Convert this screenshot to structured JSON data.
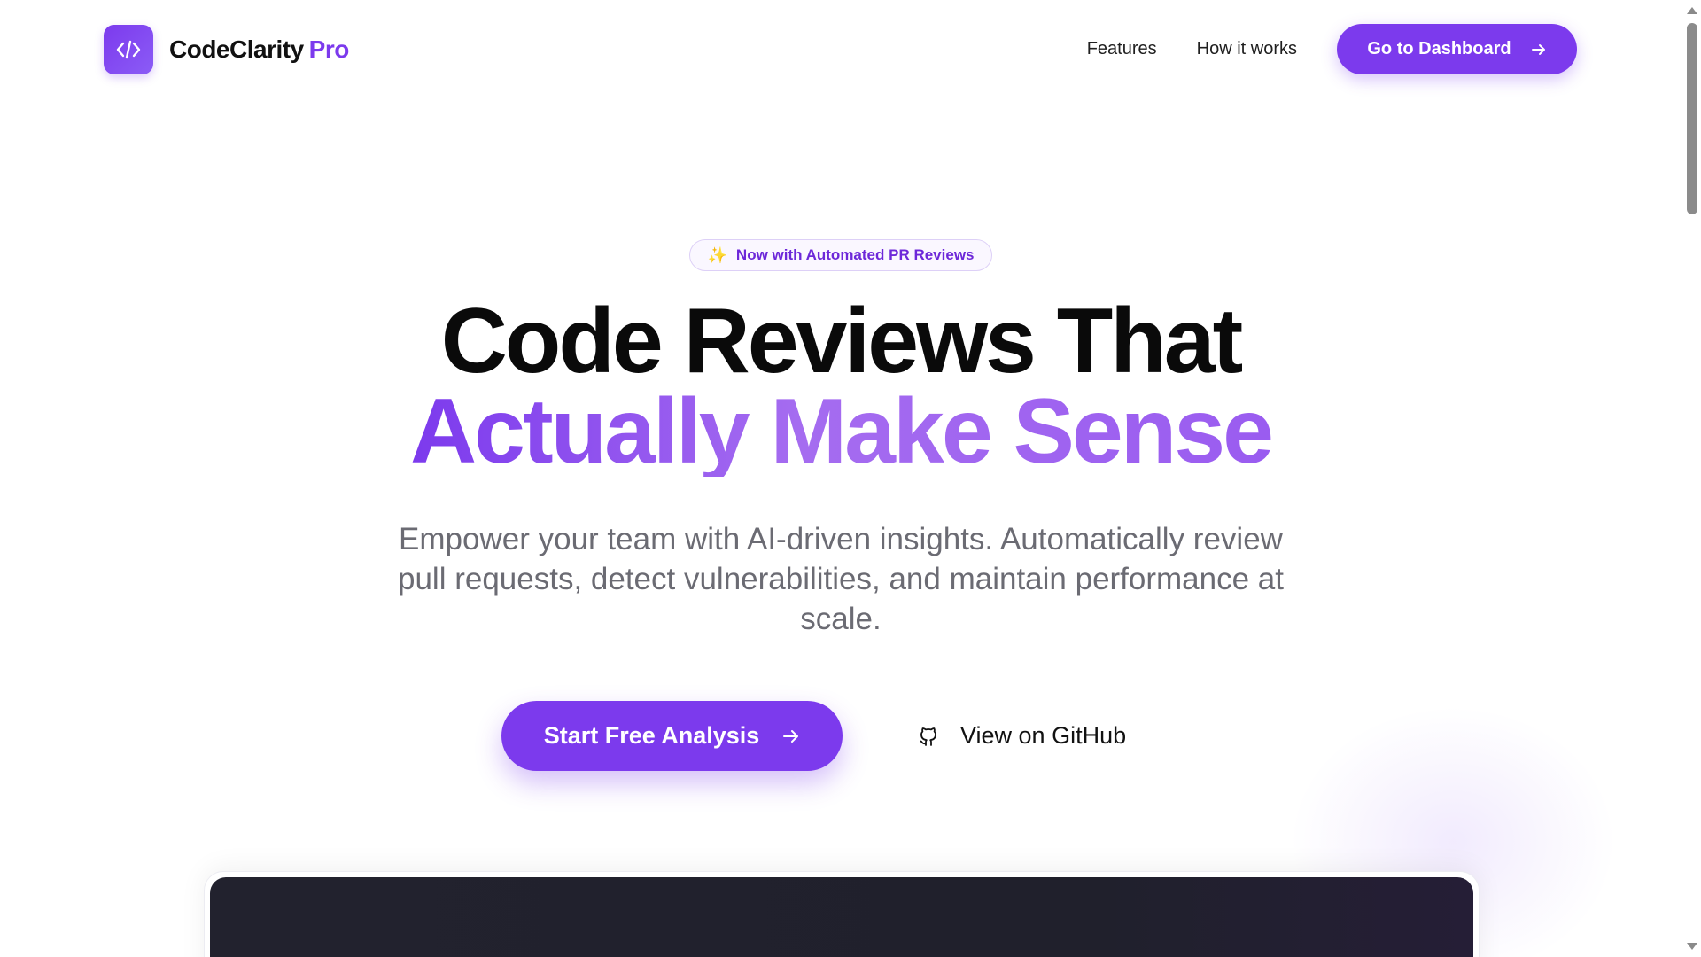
{
  "brand": {
    "name": "CodeClarity",
    "suffix": "Pro",
    "logo_icon": "code-brackets-icon"
  },
  "nav": {
    "links": [
      {
        "label": "Features"
      },
      {
        "label": "How it works"
      }
    ],
    "cta_label": "Go to Dashboard",
    "cta_icon": "arrow-right-icon"
  },
  "hero": {
    "badge": {
      "icon": "sparkles-icon",
      "text": "Now with Automated PR Reviews"
    },
    "title_line1": "Code Reviews That",
    "title_line2": "Actually Make Sense",
    "subtitle": "Empower your team with AI-driven insights. Automatically review pull requests, detect vulnerabilities, and maintain performance at scale.",
    "primary_cta": "Start Free Analysis",
    "secondary_cta": "View on GitHub",
    "secondary_icon": "github-icon"
  },
  "colors": {
    "accent": "#7c3aed",
    "accent_light": "#a56cf0",
    "text": "#0a0a0a",
    "muted": "#6b6b73",
    "preview_bg": "#22222e"
  }
}
